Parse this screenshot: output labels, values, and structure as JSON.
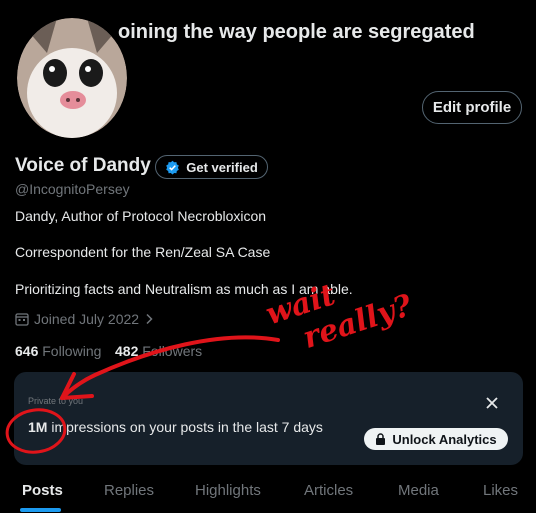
{
  "banner": {
    "text": "oining the way people are segregated"
  },
  "profile": {
    "display_name": "Voice of Dandy",
    "verify_label": "Get verified",
    "handle": "@IncognitoPersey",
    "edit_label": "Edit profile",
    "bio": [
      "Dandy, Author of Protocol Necrobloxicon",
      "Correspondent for the Ren/Zeal SA Case",
      "Prioritizing facts and Neutralism as much as I am able."
    ],
    "joined": "Joined July 2022",
    "following_count": "646",
    "following_label": "Following",
    "followers_count": "482",
    "followers_label": "Followers"
  },
  "analytics": {
    "label": "Private to you",
    "impressions": "1M",
    "impressions_text": "impressions on your posts in the last 7 days",
    "unlock_label": "Unlock Analytics"
  },
  "tabs": [
    "Posts",
    "Replies",
    "Highlights",
    "Articles",
    "Media",
    "Likes"
  ],
  "annotation": {
    "line1": "wait",
    "line2": "really?"
  },
  "colors": {
    "accent": "#1d9bf0",
    "annotation": "#e0141a",
    "panel": "#16202a"
  },
  "icons": [
    "calendar-icon",
    "verified-badge-icon",
    "lock-icon",
    "close-icon",
    "chevron-right-icon"
  ]
}
